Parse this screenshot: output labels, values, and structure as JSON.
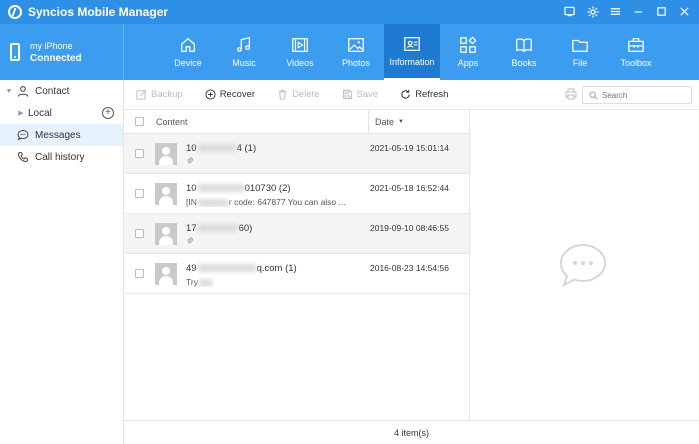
{
  "app": {
    "title": "Syncios Mobile Manager"
  },
  "device": {
    "name": "my iPhone",
    "status": "Connected"
  },
  "nav": {
    "tabs": [
      {
        "label": "Device",
        "icon": "home-icon"
      },
      {
        "label": "Music",
        "icon": "music-icon"
      },
      {
        "label": "Videos",
        "icon": "video-icon"
      },
      {
        "label": "Photos",
        "icon": "photo-icon"
      },
      {
        "label": "Information",
        "icon": "contact-card-icon",
        "active": true
      },
      {
        "label": "Apps",
        "icon": "apps-icon"
      },
      {
        "label": "Books",
        "icon": "book-icon"
      },
      {
        "label": "File",
        "icon": "folder-icon"
      },
      {
        "label": "Toolbox",
        "icon": "toolbox-icon"
      }
    ]
  },
  "sidebar": {
    "contact": "Contact",
    "local": "Local",
    "messages": "Messages",
    "call_history": "Call history"
  },
  "toolbar": {
    "backup": "Backup",
    "recover": "Recover",
    "delete": "Delete",
    "save": "Save",
    "refresh": "Refresh",
    "search_placeholder": "Search"
  },
  "list": {
    "col_content": "Content",
    "col_date": "Date",
    "rows": [
      {
        "name_a": "10",
        "name_b": "4 (1)",
        "preview": "",
        "date": "2021-05-19 15:01:14"
      },
      {
        "name_a": "10",
        "name_b": "010730 (2)",
        "preview_a": "[IN",
        "preview_b": "r code: 647877 You can also ...",
        "date": "2021-05-18 16:52:44"
      },
      {
        "name_a": "17",
        "name_b": "60)",
        "preview": "",
        "date": "2019-09-10 08:46:55"
      },
      {
        "name_a": "49",
        "name_b": "q.com (1)",
        "preview_a": "Try",
        "preview_b": "",
        "date": "2016-08-23 14:54:56"
      }
    ]
  },
  "status": {
    "count": "4 item(s)"
  },
  "colors": {
    "titlebar": "#2e8fe6",
    "navbar": "#3b9cf0",
    "active_tab": "#1f7bd2",
    "selected_row": "#e6f2fd"
  }
}
